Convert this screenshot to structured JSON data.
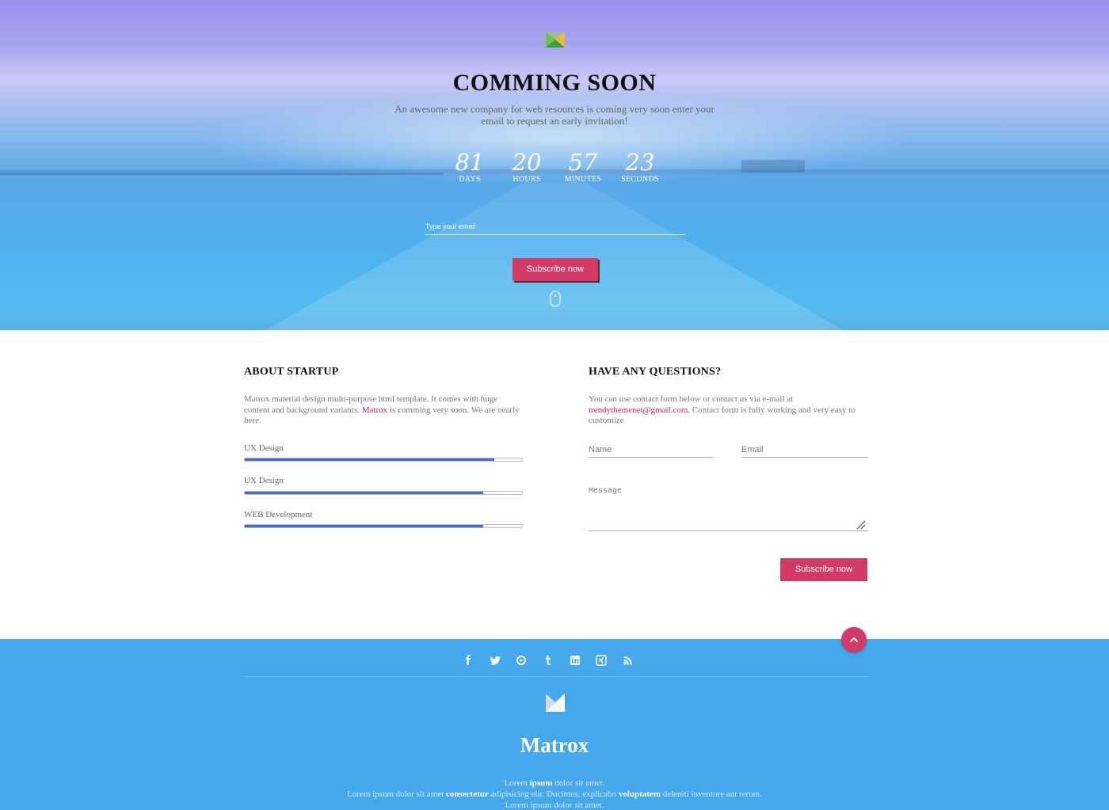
{
  "hero": {
    "title": "COMMING SOON",
    "subtitle": "An awesome new company for web resources is coming very soon enter your email to request an early invitation!",
    "countdown": [
      {
        "value": "81",
        "label": "DAYS"
      },
      {
        "value": "20",
        "label": "HOURS"
      },
      {
        "value": "57",
        "label": "MINUTES"
      },
      {
        "value": "23",
        "label": "SECONDS"
      }
    ],
    "email_placeholder": "Type your email",
    "subscribe_label": "Subscribe now"
  },
  "about": {
    "title": "ABOUT STARTUP",
    "text_before": "Matrox material design multi-purpose html template. It comes with huge content and background variants. ",
    "highlight": "Matrox",
    "text_after": " is comming very soon. We are nearly here.",
    "skills": [
      {
        "label": "UX Design",
        "progress": 0.9
      },
      {
        "label": "UX Design",
        "progress": 0.86
      },
      {
        "label": "WEB Development",
        "progress": 0.86
      }
    ]
  },
  "contact": {
    "title": "HAVE ANY QUESTIONS?",
    "text_before": "You can use contact form below or contact us via e-mail at ",
    "email": "trendythemenet@gmail.com",
    "text_after": ". Contact form is fully working and very easy to customize",
    "name_placeholder": "Name",
    "email_placeholder": "Email",
    "message_placeholder": "Message",
    "subscribe_label": "Subscribe now"
  },
  "footer": {
    "social_icons": [
      "facebook-icon",
      "twitter-icon",
      "dribbble-icon",
      "tumblr-icon",
      "linkedin-icon",
      "xing-icon",
      "rss-icon"
    ],
    "brand": "Matrox",
    "lines": [
      [
        {
          "t": "Lorem ",
          "b": false
        },
        {
          "t": "ipsum",
          "b": true
        },
        {
          "t": " dolor sit amet.",
          "b": false
        }
      ],
      [
        {
          "t": "Lorem ipsum dolor sit amet ",
          "b": false
        },
        {
          "t": "consectetur",
          "b": true
        },
        {
          "t": " adipisicing elit. Ducimus, explicabo ",
          "b": false
        },
        {
          "t": "voluptatem",
          "b": true
        },
        {
          "t": " deleniti inventore aut rerum.",
          "b": false
        }
      ],
      [
        {
          "t": "Lorem ipsum dolor sit amet.",
          "b": false
        }
      ]
    ]
  },
  "colors": {
    "accent_pink": "#d43a66",
    "progress_blue": "#3d72c8",
    "footer_blue": "#45a8ec",
    "link_red": "#d41e5b"
  }
}
